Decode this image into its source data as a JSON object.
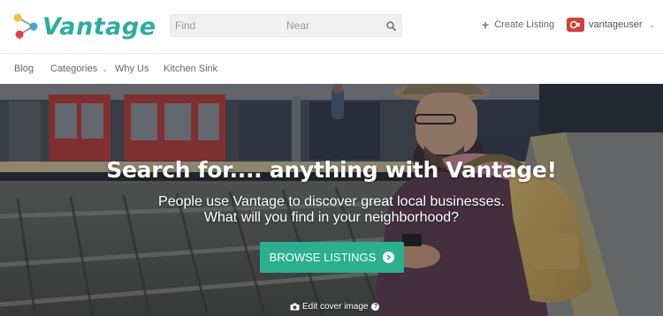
{
  "brand": {
    "name": "Vantage",
    "accent": "#2aaf9f"
  },
  "search": {
    "find_placeholder": "Find",
    "near_placeholder": "Near",
    "icon": "search-icon"
  },
  "header": {
    "create_listing": "Create Listing",
    "username": "vantageuser"
  },
  "nav": {
    "items": [
      {
        "label": "Blog"
      },
      {
        "label": "Categories",
        "has_dropdown": true
      },
      {
        "label": "Why Us"
      },
      {
        "label": "Kitchen Sink"
      }
    ]
  },
  "hero": {
    "title": "Search for.... anything with Vantage!",
    "subtitle_line1": "People use Vantage to discover great local businesses.",
    "subtitle_line2": "What will you find in your neighborhood?",
    "cta": "BROWSE LISTINGS",
    "cta_color": "#2aaf8f",
    "edit_cover": "Edit cover image"
  }
}
